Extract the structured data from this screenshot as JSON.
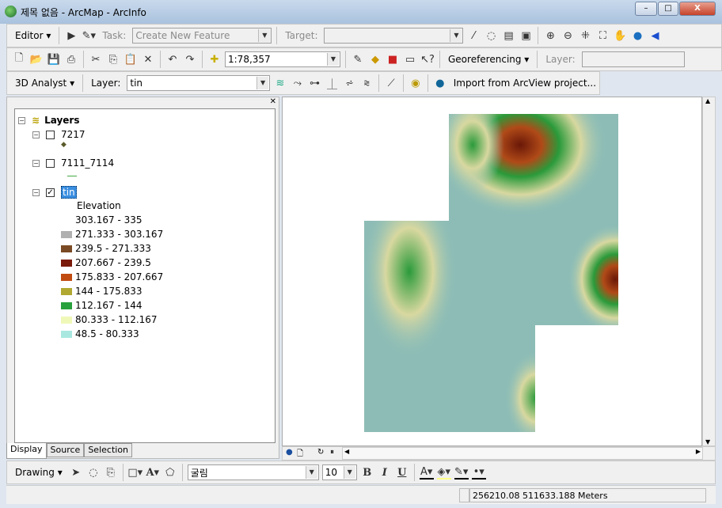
{
  "window": {
    "title": "제목 없음 - ArcMap - ArcInfo",
    "min": "–",
    "max": "□",
    "close": "X"
  },
  "editor_toolbar": {
    "editor": "Editor ▾",
    "task_label": "Task:",
    "task_value": "Create New Feature",
    "target_label": "Target:",
    "target_value": ""
  },
  "standard_toolbar": {
    "scale": "1:78,357",
    "georeferencing": "Georeferencing ▾",
    "layer_label": "Layer:",
    "layer_value": ""
  },
  "analyst_toolbar": {
    "analyst": "3D Analyst ▾",
    "layer_label": "Layer:",
    "layer_value": "tin",
    "import": "Import from ArcView project..."
  },
  "toc": {
    "root": "Layers",
    "layers": [
      {
        "name": "7217",
        "checked": false
      },
      {
        "name": "7111_7114",
        "checked": false
      },
      {
        "name": "tin",
        "checked": true
      }
    ],
    "legend_heading": "Elevation",
    "legend": [
      {
        "label": "303.167 - 335",
        "color": "#ffffff"
      },
      {
        "label": "271.333 - 303.167",
        "color": "#b0b0b0"
      },
      {
        "label": "239.5 - 271.333",
        "color": "#7a4a24"
      },
      {
        "label": "207.667 - 239.5",
        "color": "#7a1a0a"
      },
      {
        "label": "175.833 - 207.667",
        "color": "#c04a10"
      },
      {
        "label": "144 - 175.833",
        "color": "#b0a830"
      },
      {
        "label": "112.167 - 144",
        "color": "#28a03c"
      },
      {
        "label": "80.333 - 112.167",
        "color": "#f0f8b8"
      },
      {
        "label": "48.5 - 80.333",
        "color": "#a8e8e0"
      }
    ],
    "tabs": [
      "Display",
      "Source",
      "Selection"
    ]
  },
  "drawing_toolbar": {
    "drawing": "Drawing ▾",
    "font": "굴림",
    "size": "10",
    "bold": "B",
    "italic": "I",
    "underline": "U"
  },
  "status": {
    "coords": "256210.08  511633.188 Meters"
  }
}
